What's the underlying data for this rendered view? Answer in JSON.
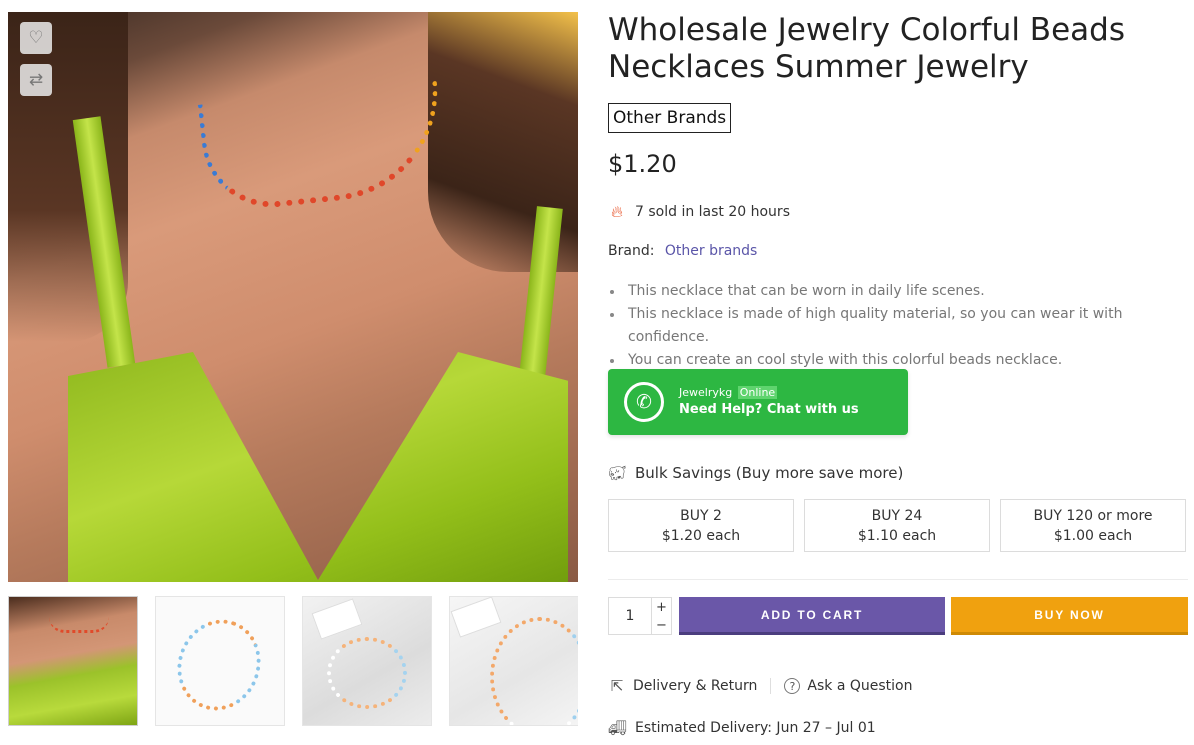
{
  "gallery": {
    "wishlist_icon": "heart-icon",
    "compare_icon": "compare-arrows-icon",
    "main_image_alt": "Woman wearing colorful beads necklace with green satin top",
    "thumbnails": [
      "model-thumbnail",
      "necklace-flat-thumbnail",
      "necklace-card-thumbnail",
      "necklace-fabric-thumbnail"
    ]
  },
  "product": {
    "title": "Wholesale Jewelry Colorful Beads Necklaces Summer Jewelry",
    "vendor_badge": "Other Brands",
    "price": "$1.20",
    "sold_text": "7 sold in last 20 hours",
    "brand_label": "Brand:",
    "brand_value": "Other brands",
    "features": [
      "This necklace that can be worn in daily life scenes.",
      "This necklace is made of high quality material, so you can wear it with confidence.",
      "You can create an cool style with this colorful beads necklace."
    ]
  },
  "whatsapp": {
    "name": "Jewelrykg",
    "status": "Online",
    "cta": "Need Help? Chat with us",
    "color": "#2db742"
  },
  "bulk": {
    "title": "Bulk Savings (Buy more save more)",
    "tiers": [
      {
        "qty": "BUY 2",
        "price": "$1.20 each"
      },
      {
        "qty": "BUY 24",
        "price": "$1.10 each"
      },
      {
        "qty": "BUY 120 or more",
        "price": "$1.00 each"
      }
    ]
  },
  "purchase": {
    "quantity": "1",
    "plus": "+",
    "minus": "−",
    "add_to_cart": "ADD TO CART",
    "buy_now": "BUY NOW",
    "add_to_cart_color": "#6a57a8",
    "buy_now_color": "#f0a10f"
  },
  "links": {
    "delivery_return": "Delivery & Return",
    "ask_question": "Ask a Question",
    "estimated_delivery": "Estimated Delivery: Jun 27 – Jul 01"
  }
}
